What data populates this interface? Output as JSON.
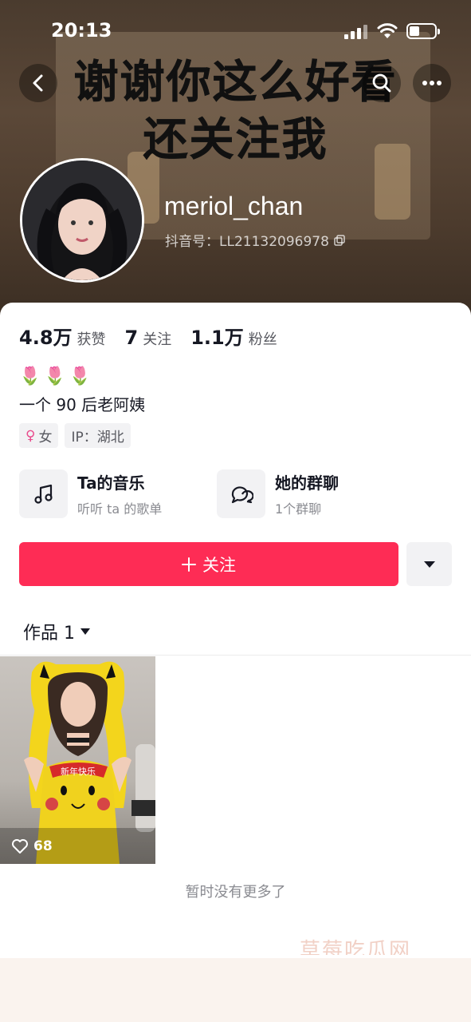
{
  "status_bar": {
    "time": "20:13"
  },
  "cover": {
    "caption_line1": "谢谢你这么好看",
    "caption_line2": "还关注我"
  },
  "profile": {
    "username": "meriol_chan",
    "douyin_id": "抖音号：LL21132096978"
  },
  "stats": [
    {
      "value": "4.8万",
      "label": "获赞"
    },
    {
      "value": "7",
      "label": "关注"
    },
    {
      "value": "1.1万",
      "label": "粉丝"
    }
  ],
  "bio": {
    "emojis": "🌷🌷🌷",
    "text": "一个 90 后老阿姨",
    "tags": {
      "gender": "女",
      "ip": "IP：湖北"
    }
  },
  "features": {
    "music": {
      "title": "Ta的音乐",
      "subtitle": "听听 ta 的歌单",
      "icon": "music-note-icon"
    },
    "group": {
      "title": "她的群聊",
      "subtitle": "1个群聊",
      "icon": "chat-bubbles-icon"
    }
  },
  "actions": {
    "follow_label": "关注"
  },
  "works": {
    "tab_label": "作品 1",
    "items": [
      {
        "likes": "68",
        "caption": "新年快乐"
      }
    ],
    "end_text": "暂时没有更多了"
  },
  "watermark": "草莓吃瓜网",
  "colors": {
    "accent": "#fe2c55",
    "text": "#161823",
    "muted": "#8a8b91"
  }
}
